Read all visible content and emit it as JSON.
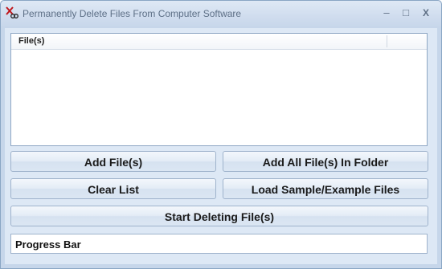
{
  "window": {
    "title": "Permanently Delete Files From Computer Software",
    "icon": "scissors-cross-icon",
    "controls": {
      "minimize": "–",
      "maximize": "□",
      "close": "X"
    }
  },
  "file_list": {
    "columns": [
      "File(s)"
    ],
    "rows": []
  },
  "buttons": {
    "add_files": "Add File(s)",
    "add_folder": "Add All File(s) In Folder",
    "clear_list": "Clear List",
    "load_samples": "Load Sample/Example Files",
    "start_deleting": "Start Deleting File(s)"
  },
  "progress": {
    "label": "Progress Bar",
    "value": 0
  },
  "colors": {
    "title_text": "#5d6f86",
    "window_bg": "#dde8f5",
    "border": "#8ea7c4"
  }
}
